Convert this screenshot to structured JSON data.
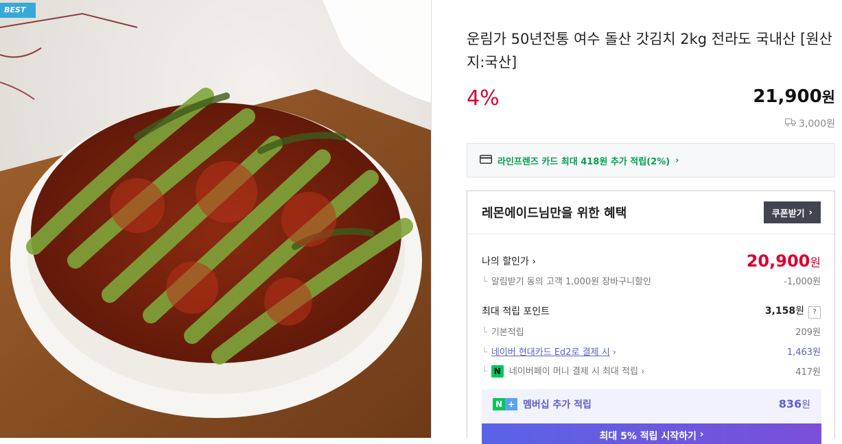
{
  "badge": "BEST",
  "product": {
    "title": "운림가 50년전통 여수 돌산 갓김치 2kg 전라도 국내산 [원산지:국산]",
    "discount_rate": "4%",
    "price": "21,900",
    "price_unit": "원",
    "shipping_fee": "3,000원"
  },
  "card_benefit": {
    "text": "라인프렌즈 카드 최대 418원 추가 적립(2%)",
    "chevron": "›"
  },
  "benefit": {
    "title": "레몬에이드님만을 위한 혜택",
    "coupon_button": "쿠폰받기",
    "my_price_label": "나의 할인가",
    "my_price_value": "20,900",
    "my_price_unit": "원",
    "discount_note": "알림받기 동의 고객 1,000원 장바구니할인",
    "discount_amount": "-1,000원",
    "max_points_label": "최대 적립 포인트",
    "max_points_value": "3,158",
    "max_points_unit": "원",
    "question_mark": "?",
    "basic_label": "기본적립",
    "basic_value": "209원",
    "card_label": "네이버 현대카드 Ed2로 결제 시",
    "card_value": "1,463원",
    "npay_label": "네이버페이 머니 결제 시 최대 적립",
    "npay_value": "417원",
    "npay_icon_text": "N",
    "membership_label": "멤버십 추가 적립",
    "membership_value": "836",
    "membership_unit": "원",
    "membership_icon_text": [
      "N",
      "+"
    ],
    "start_button": "최대 5% 적립 시작하기"
  },
  "colors": {
    "discount_red": "#d7002f",
    "naver_green": "#03c75a",
    "membership_purple": "#5d5fc8",
    "badge_blue": "#36a9d8"
  },
  "icons": [
    "truck-icon",
    "card-icon",
    "chevron-right-icon",
    "question-icon",
    "npay-icon",
    "naver-plus-icon"
  ]
}
